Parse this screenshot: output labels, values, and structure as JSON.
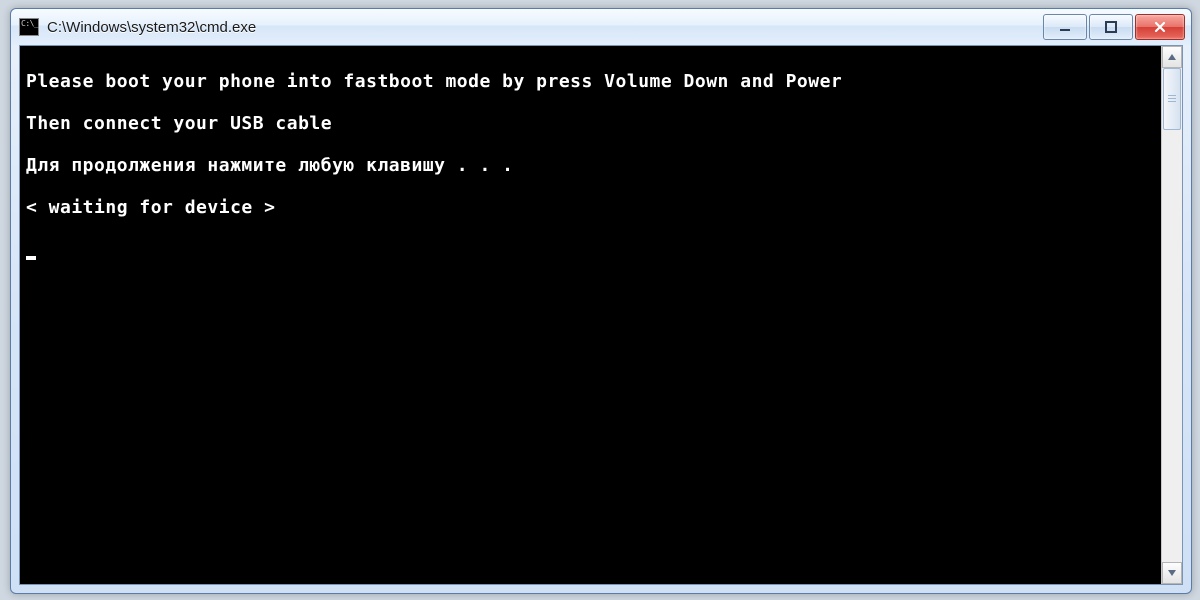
{
  "window": {
    "title": "C:\\Windows\\system32\\cmd.exe"
  },
  "console": {
    "lines": [
      "Please boot your phone into fastboot mode by press Volume Down and Power",
      "Then connect your USB cable",
      "Для продолжения нажмите любую клавишу . . .",
      "< waiting for device >"
    ]
  }
}
